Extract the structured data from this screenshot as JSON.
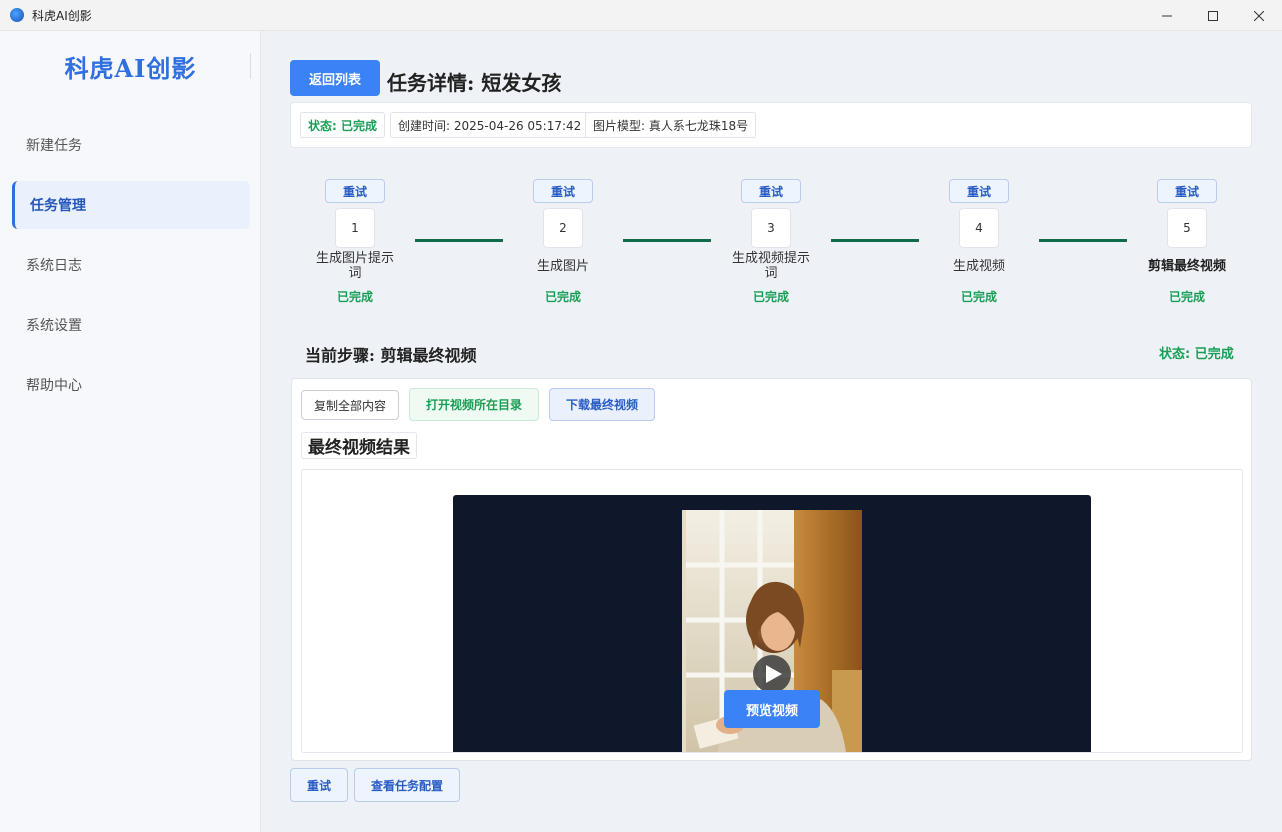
{
  "window": {
    "title": "科虎AI创影",
    "min_icon": "minimize-icon",
    "max_icon": "maximize-icon",
    "close_icon": "close-icon"
  },
  "sidebar": {
    "brand": "科虎AI创影",
    "items": [
      {
        "label": "新建任务",
        "active": false
      },
      {
        "label": "任务管理",
        "active": true
      },
      {
        "label": "系统日志",
        "active": false
      },
      {
        "label": "系统设置",
        "active": false
      },
      {
        "label": "帮助中心",
        "active": false
      }
    ]
  },
  "header": {
    "back_label": "返回列表",
    "title": "任务详情: 短发女孩"
  },
  "info": {
    "status": "状态: 已完成",
    "created": "创建时间: 2025-04-26 05:17:42",
    "model": "图片模型: 真人系七龙珠18号"
  },
  "steps": [
    {
      "retry": "重试",
      "num": "1",
      "label": "生成图片提示词",
      "status": "已完成"
    },
    {
      "retry": "重试",
      "num": "2",
      "label": "生成图片",
      "status": "已完成"
    },
    {
      "retry": "重试",
      "num": "3",
      "label": "生成视频提示词",
      "status": "已完成"
    },
    {
      "retry": "重试",
      "num": "4",
      "label": "生成视频",
      "status": "已完成"
    },
    {
      "retry": "重试",
      "num": "5",
      "label": "剪辑最终视频",
      "status": "已完成"
    }
  ],
  "current": {
    "label": "当前步骤: 剪辑最终视频",
    "status": "状态: 已完成"
  },
  "result": {
    "copy_label": "复制全部内容",
    "open_label": "打开视频所在目录",
    "download_label": "下载最终视频",
    "title": "最终视频结果",
    "preview_label": "预览视频"
  },
  "footer": {
    "retry_label": "重试",
    "config_label": "查看任务配置"
  },
  "colors": {
    "accent": "#3b82f6",
    "success": "#1a9e55",
    "connector": "#0f6b47",
    "video_bg": "#0f172a"
  }
}
